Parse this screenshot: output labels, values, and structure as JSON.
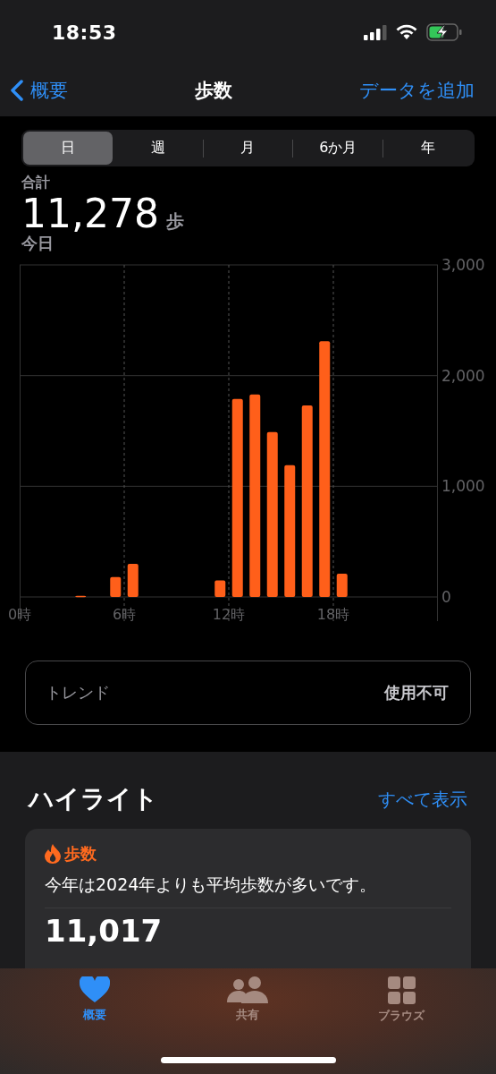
{
  "status_bar": {
    "time": "18:53"
  },
  "nav": {
    "back": "概要",
    "title": "歩数",
    "action": "データを追加"
  },
  "segments": [
    {
      "label": "日",
      "selected": true
    },
    {
      "label": "週",
      "selected": false
    },
    {
      "label": "月",
      "selected": false
    },
    {
      "label": "6か月",
      "selected": false
    },
    {
      "label": "年",
      "selected": false
    }
  ],
  "summary": {
    "label": "合計",
    "value": "11,278",
    "unit": "歩",
    "period": "今日"
  },
  "chart_data": {
    "type": "bar",
    "grid": true,
    "x": [
      3.5,
      5.5,
      6.5,
      11.5,
      12.5,
      13.5,
      14.5,
      15.5,
      16.5,
      17.5,
      18.5
    ],
    "series": [
      {
        "color": "#ff5f1a",
        "values": [
          10,
          180,
          300,
          150,
          1790,
          1830,
          1490,
          1190,
          1730,
          2310,
          210
        ]
      }
    ],
    "xlim": [
      0,
      24
    ],
    "ylim": [
      0,
      3000
    ],
    "xticks": [
      {
        "value": 0,
        "label": "0時"
      },
      {
        "value": 6,
        "label": "6時"
      },
      {
        "value": 12,
        "label": "12時"
      },
      {
        "value": 18,
        "label": "18時"
      }
    ],
    "yticks": [
      {
        "value": 0,
        "label": "0"
      },
      {
        "value": 1000,
        "label": "1,000"
      },
      {
        "value": 2000,
        "label": "2,000"
      },
      {
        "value": 3000,
        "label": "3,000"
      }
    ]
  },
  "trend": {
    "label": "トレンド",
    "value": "使用不可"
  },
  "highlights": {
    "title": "ハイライト",
    "link": "すべて表示",
    "card": {
      "category": "歩数",
      "text": "今年は2024年よりも平均歩数が多いです。",
      "value": "11,017"
    }
  },
  "tab_bar": [
    {
      "label": "概要",
      "kind": "heart",
      "selected": true
    },
    {
      "label": "共有",
      "kind": "people",
      "selected": false
    },
    {
      "label": "ブラウズ",
      "kind": "grid",
      "selected": false
    }
  ]
}
